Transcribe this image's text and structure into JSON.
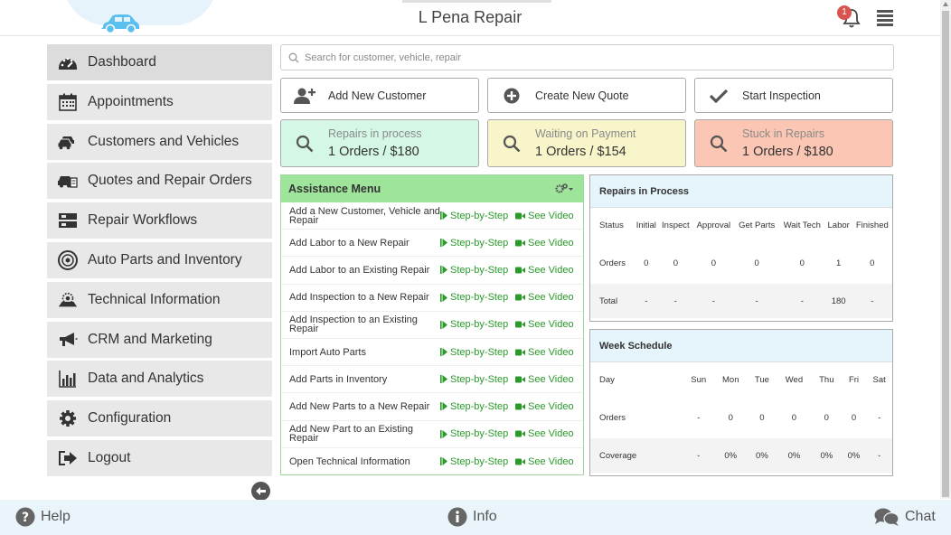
{
  "header": {
    "title": "L Pena Repair",
    "notification_count": "1",
    "logo_icon": "car-icon",
    "brand_color": "#5bc0f0"
  },
  "sidebar": {
    "items": [
      {
        "label": "Dashboard",
        "icon": "dashboard-gauge-icon"
      },
      {
        "label": "Appointments",
        "icon": "calendar-icon"
      },
      {
        "label": "Customers and Vehicles",
        "icon": "cars-icon"
      },
      {
        "label": "Quotes and Repair Orders",
        "icon": "car-document-icon"
      },
      {
        "label": "Repair Workflows",
        "icon": "workflow-icon"
      },
      {
        "label": "Auto Parts and Inventory",
        "icon": "tire-icon"
      },
      {
        "label": "Technical Information",
        "icon": "engine-icon"
      },
      {
        "label": "CRM and Marketing",
        "icon": "megaphone-icon"
      },
      {
        "label": "Data and Analytics",
        "icon": "bar-chart-icon"
      },
      {
        "label": "Configuration",
        "icon": "gear-icon"
      },
      {
        "label": "Logout",
        "icon": "logout-icon"
      }
    ]
  },
  "search": {
    "placeholder": "Search for customer, vehicle, repair",
    "value": ""
  },
  "actions": {
    "add_customer": "Add New Customer",
    "create_quote": "Create New Quote",
    "start_inspection": "Start Inspection"
  },
  "stats": {
    "repairs": {
      "title": "Repairs in process",
      "value": "1 Orders / $180",
      "color": "#d5f7e6"
    },
    "payment": {
      "title": "Waiting on Payment",
      "value": "1 Orders / $154",
      "color": "#f7f5c9"
    },
    "stuck": {
      "title": "Stuck in Repairs",
      "value": "1 Orders / $180",
      "color": "#fbc6b3"
    }
  },
  "assistance": {
    "title": "Assistance Menu",
    "step_label": "Step-by-Step",
    "video_label": "See Video",
    "items": [
      "Add a New Customer, Vehicle and Repair",
      "Add Labor to a New Repair",
      "Add Labor to an Existing Repair",
      "Add Inspection to a New Repair",
      "Add Inspection to an Existing Repair",
      "Import Auto Parts",
      "Add Parts in Inventory",
      "Add New Parts to a New Repair",
      "Add New Part to an Existing Repair",
      "Open Technical Information"
    ]
  },
  "repairs_table": {
    "title": "Repairs in Process",
    "headers": [
      "Status",
      "Initial",
      "Inspect",
      "Approval",
      "Get Parts",
      "Wait Tech",
      "Labor",
      "Finished"
    ],
    "orders": [
      "Orders",
      "0",
      "0",
      "0",
      "0",
      "0",
      "1",
      "0"
    ],
    "total": [
      "Total",
      "-",
      "-",
      "-",
      "-",
      "-",
      "180",
      "-"
    ]
  },
  "week_table": {
    "title": "Week Schedule",
    "headers": [
      "Day",
      "Sun",
      "Mon",
      "Tue",
      "Wed",
      "Thu",
      "Fri",
      "Sat"
    ],
    "orders": [
      "Orders",
      "-",
      "0",
      "0",
      "0",
      "0",
      "0",
      "-"
    ],
    "coverage": [
      "Coverage",
      "-",
      "0%",
      "0%",
      "0%",
      "0%",
      "0%",
      "-"
    ]
  },
  "footer": {
    "help": "Help",
    "info": "Info",
    "chat": "Chat"
  }
}
